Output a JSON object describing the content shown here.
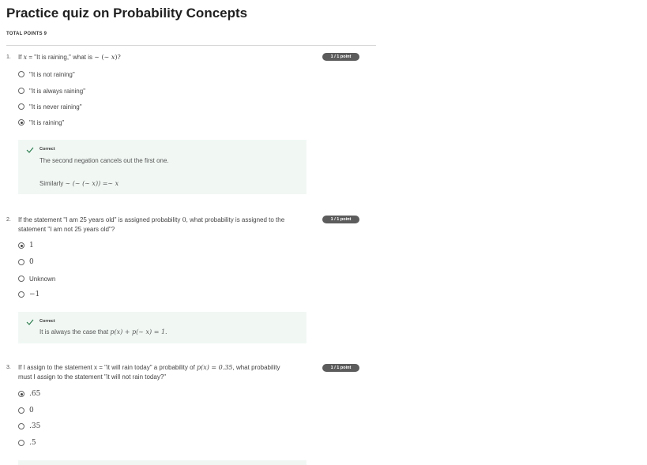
{
  "quiz": {
    "title": "Practice quiz on Probability Concepts",
    "total_points": "TOTAL POINTS 9"
  },
  "questions": [
    {
      "number": "1.",
      "text_parts": [
        "If ",
        "x",
        " = \"It is raining,\" what is ",
        "∼ (∼ ",
        "x",
        ")?"
      ],
      "badge": "1 / 1 point",
      "options": [
        "\"It is not raining\"",
        "\"It is always raining\"",
        "\"It is never raining\"",
        "\"It is raining\""
      ],
      "selected_index": 3,
      "feedback": {
        "status": "Correct",
        "line1": "The second negation cancels out the first one.",
        "line2_prefix": "Similarly ",
        "line2_math": "∼ (∼ (∼ x)) =∼ x"
      }
    },
    {
      "number": "2.",
      "text_line1_a": "If the statement \"I am 25 years old\" is assigned probability ",
      "text_line1_math": "0",
      "text_line1_b": ", what probability is assigned to the",
      "text_line2": "statement \"I am not 25 years old\"?",
      "badge": "1 / 1 point",
      "options": [
        "1",
        "0",
        "Unknown",
        "−1"
      ],
      "selected_index": 0,
      "feedback": {
        "status": "Correct",
        "prefix": "It is always the case that ",
        "math": "p(x) + p(∼ x) = 1."
      }
    },
    {
      "number": "3.",
      "text_line1_a": "If I assign to the statement x = \"it will rain today\" a probability of ",
      "text_line1_math": "p(x) = 0.35",
      "text_line1_b": ", what probability",
      "text_line2": "must I assign to the statement \"it will not rain today?\"",
      "badge": "1 / 1 point",
      "options": [
        ".65",
        "0",
        ".35",
        ".5"
      ],
      "selected_index": 0
    }
  ]
}
